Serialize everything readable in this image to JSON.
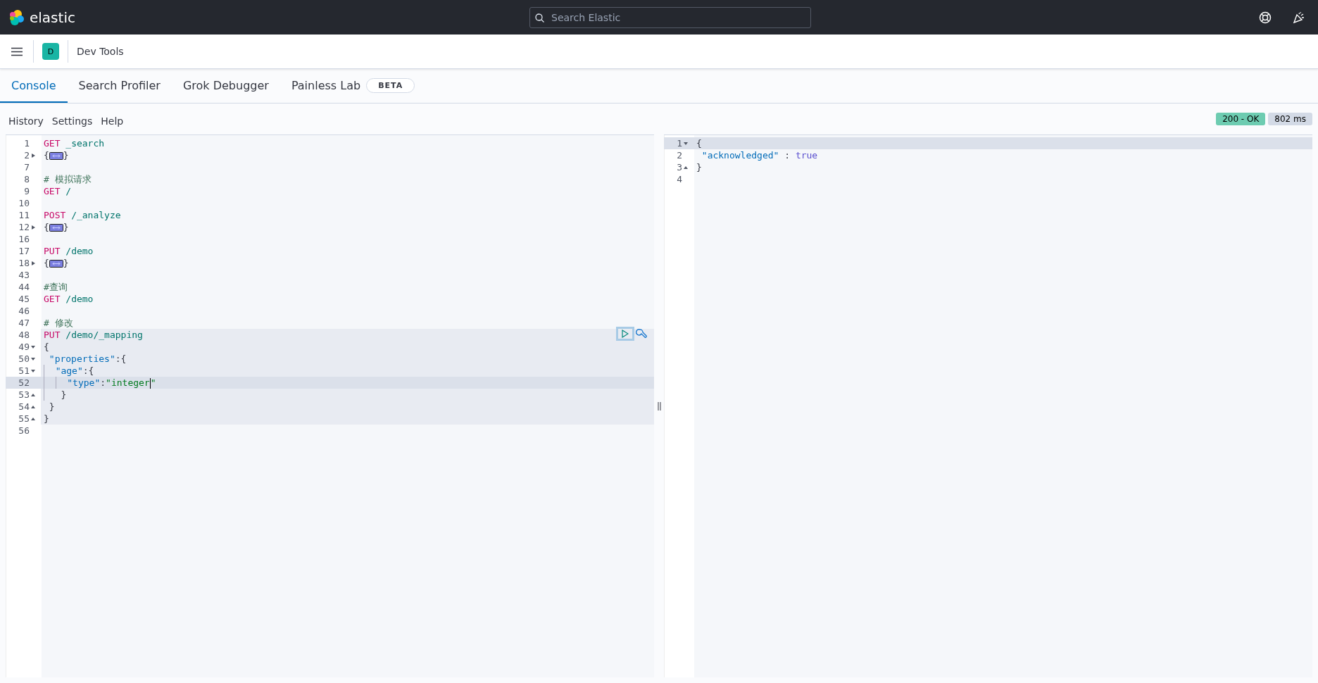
{
  "header": {
    "brand": "elastic",
    "search": {
      "placeholder": "Search Elastic"
    }
  },
  "breadcrumb": {
    "avatar": "D",
    "title": "Dev Tools"
  },
  "tabs": [
    {
      "label": "Console",
      "selected": true
    },
    {
      "label": "Search Profiler",
      "selected": false
    },
    {
      "label": "Grok Debugger",
      "selected": false
    },
    {
      "label": "Painless Lab",
      "selected": false,
      "badge": "BETA"
    }
  ],
  "toolbar": {
    "links": [
      "History",
      "Settings",
      "Help"
    ],
    "status": "200 - OK",
    "duration": "802 ms"
  },
  "request_editor": {
    "lines": [
      {
        "number": "1",
        "kind": "plain",
        "highlighted": false,
        "active": false,
        "tokens": [
          {
            "kind": "method",
            "text": "GET"
          },
          {
            "kind": "path",
            "text": " _search"
          }
        ]
      },
      {
        "number": "2",
        "kind": "folded",
        "highlighted": false,
        "active": false,
        "tokens": [
          {
            "kind": "punct",
            "text": "{"
          },
          {
            "kind": "folded"
          },
          {
            "kind": "punct",
            "text": "}"
          }
        ]
      },
      {
        "number": "7",
        "kind": "plain",
        "highlighted": false,
        "active": false
      },
      {
        "number": "8",
        "kind": "plain",
        "highlighted": false,
        "active": false,
        "tokens": [
          {
            "kind": "comment",
            "text": "# 模拟请求"
          }
        ]
      },
      {
        "number": "9",
        "kind": "plain",
        "highlighted": false,
        "active": false,
        "tokens": [
          {
            "kind": "method",
            "text": "GET"
          },
          {
            "kind": "path",
            "text": " /"
          }
        ]
      },
      {
        "number": "10",
        "kind": "plain",
        "highlighted": false,
        "active": false
      },
      {
        "number": "11",
        "kind": "plain",
        "highlighted": false,
        "active": false,
        "tokens": [
          {
            "kind": "method",
            "text": "POST"
          },
          {
            "kind": "path",
            "text": " /_analyze"
          }
        ]
      },
      {
        "number": "12",
        "kind": "folded",
        "highlighted": false,
        "active": false,
        "tokens": [
          {
            "kind": "punct",
            "text": "{"
          },
          {
            "kind": "folded"
          },
          {
            "kind": "punct",
            "text": "}"
          }
        ]
      },
      {
        "number": "16",
        "kind": "plain",
        "highlighted": false,
        "active": false
      },
      {
        "number": "17",
        "kind": "plain",
        "highlighted": false,
        "active": false,
        "tokens": [
          {
            "kind": "method",
            "text": "PUT"
          },
          {
            "kind": "path",
            "text": " /demo"
          }
        ]
      },
      {
        "number": "18",
        "kind": "folded",
        "highlighted": false,
        "active": false,
        "tokens": [
          {
            "kind": "punct",
            "text": "{"
          },
          {
            "kind": "folded"
          },
          {
            "kind": "punct",
            "text": "}"
          }
        ]
      },
      {
        "number": "43",
        "kind": "plain",
        "highlighted": false,
        "active": false
      },
      {
        "number": "44",
        "kind": "plain",
        "highlighted": false,
        "active": false,
        "tokens": [
          {
            "kind": "comment",
            "text": "#查询"
          }
        ]
      },
      {
        "number": "45",
        "kind": "plain",
        "highlighted": false,
        "active": false,
        "tokens": [
          {
            "kind": "method",
            "text": "GET"
          },
          {
            "kind": "path",
            "text": " /demo"
          }
        ]
      },
      {
        "number": "46",
        "kind": "plain",
        "highlighted": false,
        "active": false
      },
      {
        "number": "47",
        "kind": "plain",
        "highlighted": false,
        "active": false,
        "tokens": [
          {
            "kind": "comment",
            "text": "# 修改"
          }
        ]
      },
      {
        "number": "48",
        "kind": "plain",
        "highlighted": true,
        "active": false,
        "tokens": [
          {
            "kind": "method",
            "text": "PUT"
          },
          {
            "kind": "path",
            "text": " /demo/_mapping"
          }
        ]
      },
      {
        "number": "49",
        "kind": "fold_start",
        "highlighted": true,
        "active": false,
        "tokens": [
          {
            "kind": "punct",
            "text": "{"
          }
        ]
      },
      {
        "number": "50",
        "kind": "fold_start",
        "highlighted": true,
        "active": false,
        "tokens": [
          {
            "kind": "space"
          },
          {
            "kind": "key",
            "text": "\"properties\""
          },
          {
            "kind": "punct",
            "text": ":{"
          }
        ]
      },
      {
        "number": "51",
        "kind": "fold_start",
        "highlighted": true,
        "active": false,
        "tokens": [
          {
            "kind": "guide"
          },
          {
            "kind": "key",
            "text": "\"age\""
          },
          {
            "kind": "punct",
            "text": ":{"
          }
        ]
      },
      {
        "number": "52",
        "kind": "plain",
        "highlighted": true,
        "active": true,
        "tokens": [
          {
            "kind": "guide"
          },
          {
            "kind": "guide"
          },
          {
            "kind": "key",
            "text": "\"type\""
          },
          {
            "kind": "punct",
            "text": ":"
          },
          {
            "kind": "string",
            "text": "\"integer"
          },
          {
            "kind": "cursor"
          },
          {
            "kind": "string",
            "text": "\""
          }
        ]
      },
      {
        "number": "53",
        "kind": "fold_end",
        "highlighted": true,
        "active": false,
        "tokens": [
          {
            "kind": "guide"
          },
          {
            "kind": "space"
          },
          {
            "kind": "punct",
            "text": "}"
          }
        ]
      },
      {
        "number": "54",
        "kind": "fold_end",
        "highlighted": true,
        "active": false,
        "tokens": [
          {
            "kind": "space"
          },
          {
            "kind": "punct",
            "text": "}"
          }
        ]
      },
      {
        "number": "55",
        "kind": "fold_end",
        "highlighted": true,
        "active": false,
        "tokens": [
          {
            "kind": "punct",
            "text": "}"
          }
        ]
      },
      {
        "number": "56",
        "kind": "plain",
        "highlighted": false,
        "active": false
      }
    ]
  },
  "response_editor": {
    "lines": [
      {
        "number": "1",
        "kind": "fold_start",
        "highlighted": false,
        "active": true,
        "tokens": [
          {
            "kind": "punct",
            "text": "{"
          }
        ]
      },
      {
        "number": "2",
        "kind": "plain",
        "highlighted": false,
        "active": false,
        "tokens": [
          {
            "kind": "space"
          },
          {
            "kind": "key",
            "text": "\"acknowledged\""
          },
          {
            "kind": "punct",
            "text": " : "
          },
          {
            "kind": "value",
            "text": "true"
          }
        ]
      },
      {
        "number": "3",
        "kind": "fold_end",
        "highlighted": false,
        "active": false,
        "tokens": [
          {
            "kind": "punct",
            "text": "}"
          }
        ]
      },
      {
        "number": "4",
        "kind": "plain",
        "highlighted": false,
        "active": false
      }
    ]
  }
}
